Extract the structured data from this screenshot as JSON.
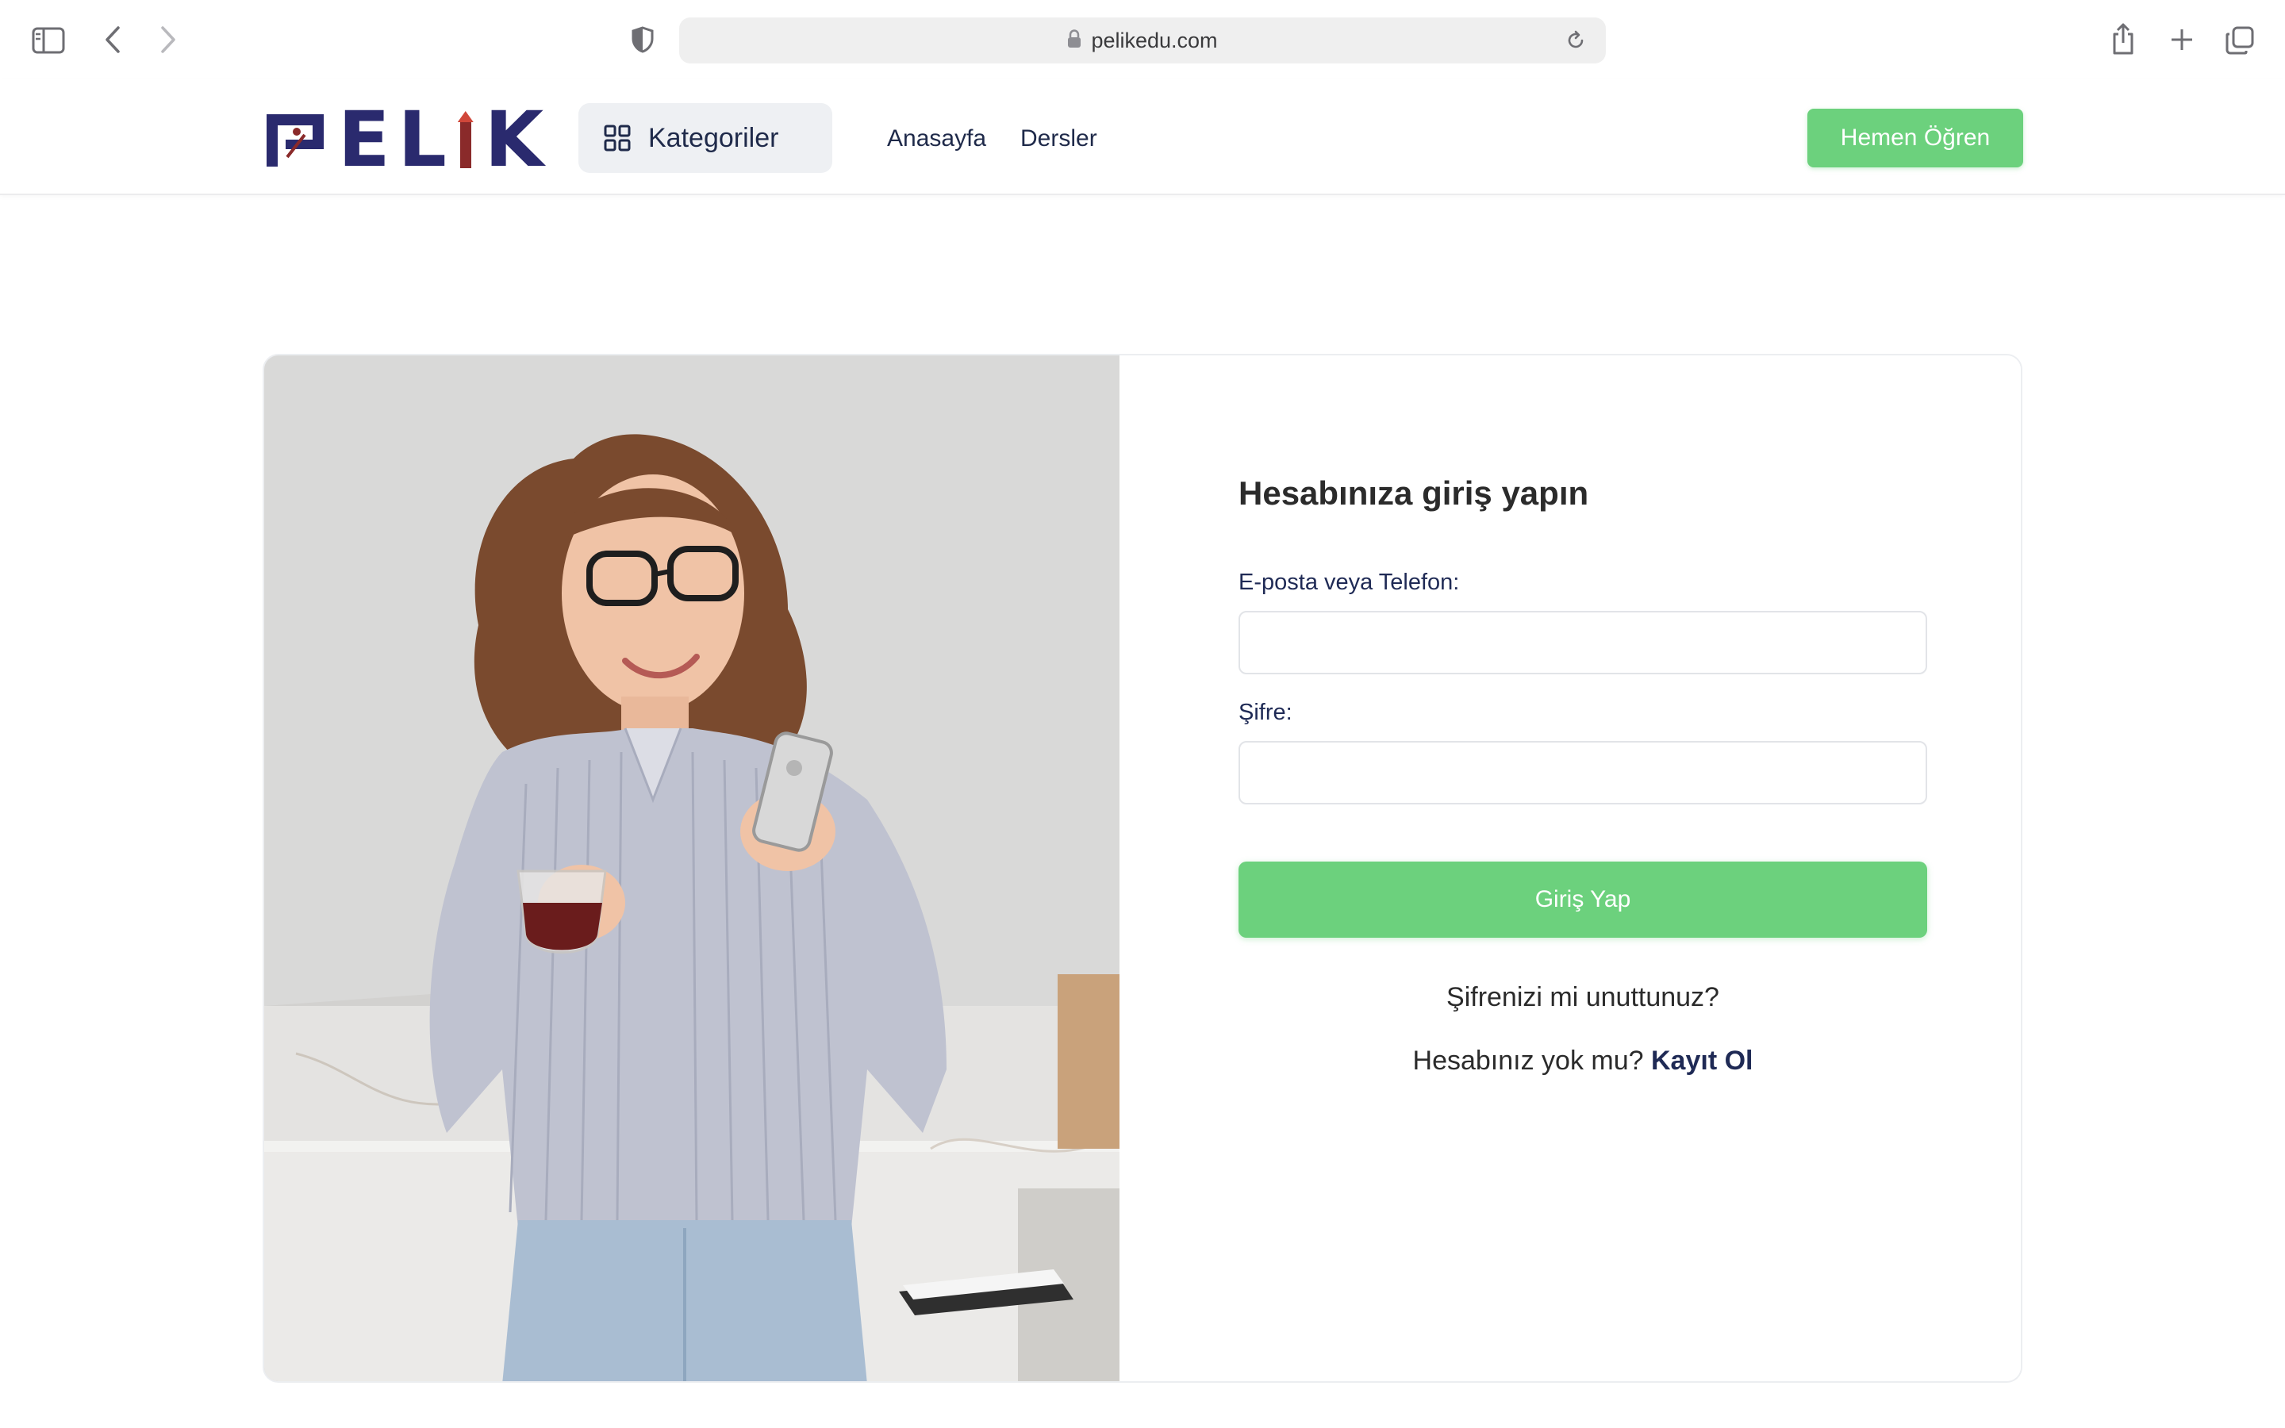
{
  "browser": {
    "url": "pelikedu.com",
    "icons": [
      "sidebar-icon",
      "back-icon",
      "forward-icon",
      "shield-icon",
      "lock-icon",
      "reload-icon",
      "share-icon",
      "new-tab-icon",
      "tabs-overview-icon"
    ]
  },
  "header": {
    "logo_text": "PELIK",
    "categories_label": "Kategoriler",
    "nav": [
      {
        "label": "Anasayfa"
      },
      {
        "label": "Dersler"
      }
    ],
    "cta_label": "Hemen Öğren"
  },
  "login": {
    "title": "Hesabınıza giriş yapın",
    "email_label": "E-posta veya Telefon:",
    "email_value": "",
    "password_label": "Şifre:",
    "password_value": "",
    "submit_label": "Giriş Yap",
    "forgot_label": "Şifrenizi mi unuttunuz?",
    "signup_prompt": "Hesabınız yok mu?",
    "signup_label": "Kayıt Ol"
  },
  "colors": {
    "brand_navy": "#2a2a6e",
    "accent_green": "#6cd17d",
    "logo_red": "#8a2a2a"
  }
}
